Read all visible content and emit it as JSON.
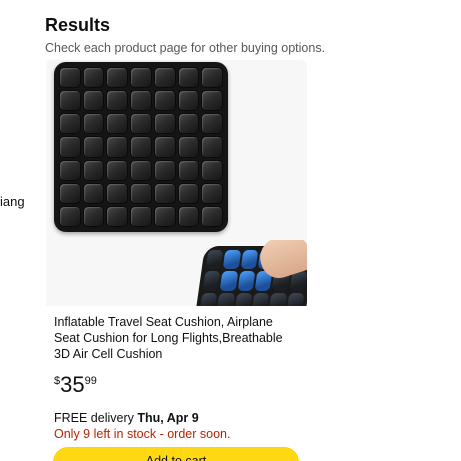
{
  "left_fragment": "iang",
  "results": {
    "title": "Results",
    "subtitle": "Check each product page for other buying options."
  },
  "product": {
    "title": "Inflatable Travel Seat Cushion, Airplane Seat Cushion for Long Flights,Breathable 3D Air Cell Cushion",
    "price": {
      "symbol": "$",
      "whole": "35",
      "fraction": "99"
    },
    "delivery": {
      "prefix": "FREE delivery ",
      "date": "Thu, Apr 9"
    },
    "stock": "Only 9 left in stock - order soon.",
    "button_label": "Add to cart"
  },
  "colors": {
    "price_stock": "#b12704",
    "button": "#ffd814",
    "subtitle": "#565959"
  }
}
